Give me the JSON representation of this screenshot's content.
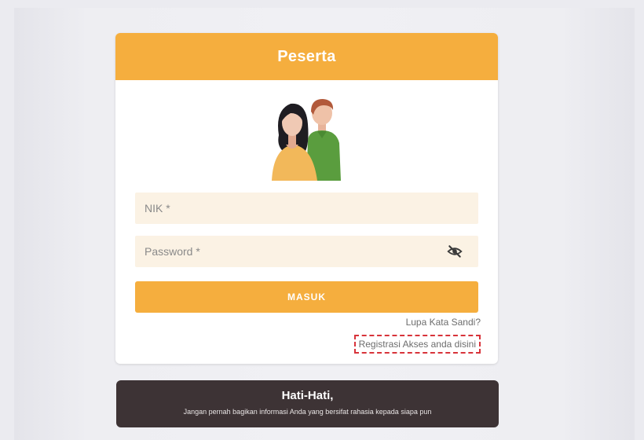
{
  "login": {
    "title": "Peserta",
    "nik_placeholder": "NIK *",
    "password_placeholder": "Password *",
    "submit_label": "MASUK",
    "forgot_link": "Lupa Kata Sandi?",
    "register_link": "Registrasi Akses anda disini",
    "password_toggle_icon": "eye-off-icon",
    "illustration": "users-illustration"
  },
  "warning": {
    "title": "Hati-Hati,",
    "text": "Jangan pernah bagikan informasi Anda yang bersifat rahasia kepada siapa pun"
  },
  "colors": {
    "accent": "#f5ae3e",
    "input_bg": "#fbf2e4",
    "warning_bg": "#3d3335",
    "highlight": "#d8333a"
  }
}
